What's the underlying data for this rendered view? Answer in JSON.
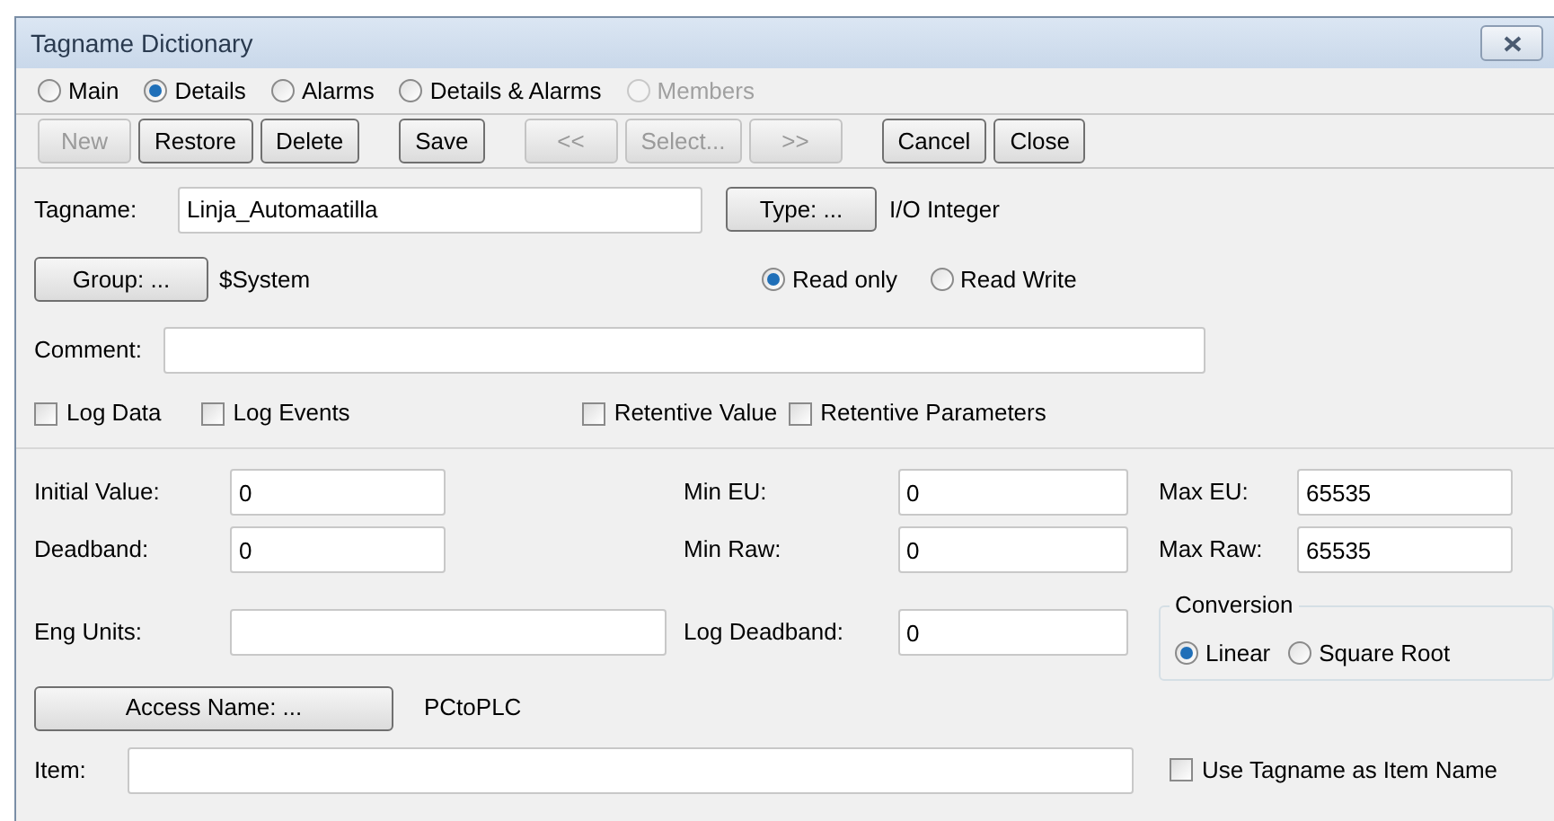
{
  "window": {
    "title": "Tagname Dictionary"
  },
  "views": [
    {
      "label": "Main",
      "selected": false,
      "disabled": false
    },
    {
      "label": "Details",
      "selected": true,
      "disabled": false
    },
    {
      "label": "Alarms",
      "selected": false,
      "disabled": false
    },
    {
      "label": "Details & Alarms",
      "selected": false,
      "disabled": false
    },
    {
      "label": "Members",
      "selected": false,
      "disabled": true
    }
  ],
  "toolbar_groups": [
    [
      {
        "label": "New",
        "disabled": true
      },
      {
        "label": "Restore",
        "disabled": false
      },
      {
        "label": "Delete",
        "disabled": false
      }
    ],
    [
      {
        "label": "Save",
        "disabled": false
      }
    ],
    [
      {
        "label": "<<",
        "disabled": true
      },
      {
        "label": "Select...",
        "disabled": true
      },
      {
        "label": ">>",
        "disabled": true
      }
    ],
    [
      {
        "label": "Cancel",
        "disabled": false
      },
      {
        "label": "Close",
        "disabled": false
      }
    ]
  ],
  "tagname": {
    "label": "Tagname:",
    "value": "Linja_Automaatilla"
  },
  "type": {
    "button": "Type: ...",
    "value": "I/O Integer"
  },
  "group": {
    "button": "Group: ...",
    "value": "$System"
  },
  "access_modes": [
    {
      "label": "Read only",
      "selected": true
    },
    {
      "label": "Read Write",
      "selected": false
    }
  ],
  "comment": {
    "label": "Comment:"
  },
  "logging": [
    {
      "label": "Log Data",
      "checked": false
    },
    {
      "label": "Log Events",
      "checked": false
    }
  ],
  "retentive": [
    {
      "label": "Retentive Value",
      "checked": false
    },
    {
      "label": "Retentive Parameters",
      "checked": false
    }
  ],
  "initial_value": {
    "label": "Initial Value:",
    "value": "0"
  },
  "deadband": {
    "label": "Deadband:",
    "value": "0"
  },
  "eng_units": {
    "label": "Eng Units:"
  },
  "min_eu": {
    "label": "Min EU:",
    "value": "0"
  },
  "min_raw": {
    "label": "Min Raw:",
    "value": "0"
  },
  "log_deadband": {
    "label": "Log Deadband:",
    "value": "0"
  },
  "max_eu": {
    "label": "Max EU:",
    "value": "65535"
  },
  "max_raw": {
    "label": "Max Raw:",
    "value": "65535"
  },
  "conversion": {
    "title": "Conversion",
    "options": [
      {
        "label": "Linear",
        "selected": true
      },
      {
        "label": "Square Root",
        "selected": false
      }
    ]
  },
  "access_name": {
    "button": "Access Name: ...",
    "value": "PCtoPLC"
  },
  "item": {
    "label": "Item:"
  },
  "use_tagname": {
    "label": "Use Tagname as Item Name",
    "checked": false
  }
}
